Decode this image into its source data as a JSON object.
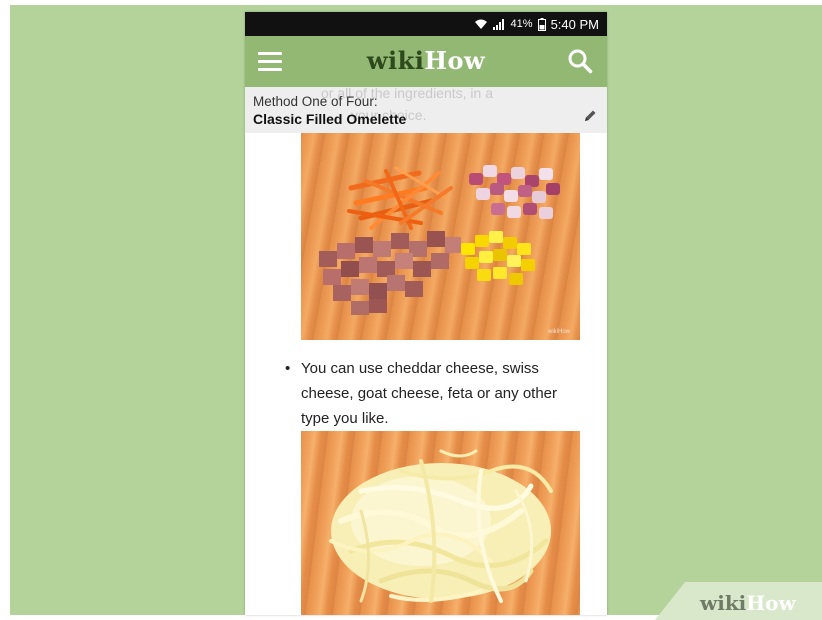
{
  "status_bar": {
    "battery": "41%",
    "time": "5:40 PM"
  },
  "app_bar": {
    "logo_part1": "wiki",
    "logo_part2": "How"
  },
  "header": {
    "ghost_line1": "or all of the ingredients, in a",
    "ghost_line2": "your choice.",
    "method_label": "Method One of Four:",
    "method_title": "Classic Filled Omelette"
  },
  "content": {
    "image1_credit": "wikiHow",
    "bullet_marker": "•",
    "bullet_text": "You can use cheddar cheese, swiss cheese, goat cheese, feta or any other type you like."
  },
  "watermark": {
    "part1": "wiki",
    "part2": "How"
  },
  "colors": {
    "background": "#b3d39a",
    "app_bar": "#93b874",
    "logo_dark": "#2e4a1c",
    "status_bar": "#111111"
  }
}
